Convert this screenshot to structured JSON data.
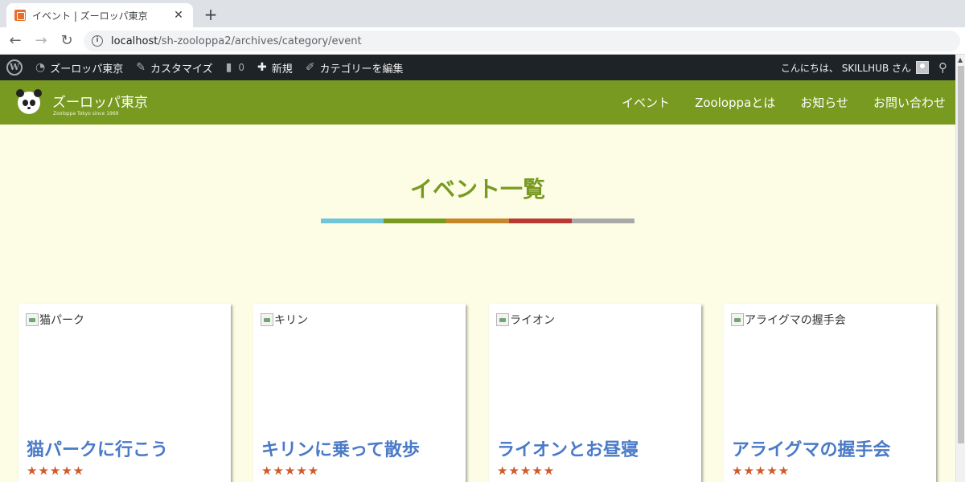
{
  "browser": {
    "tab_title": "イベント | ズーロッパ東京",
    "url_host": "localhost",
    "url_path": "/sh-zooloppa2/archives/category/event"
  },
  "adminbar": {
    "site_name": "ズーロッパ東京",
    "customize": "カスタマイズ",
    "comments_count": "0",
    "new_label": "新規",
    "edit_category": "カテゴリーを編集",
    "greeting": "こんにちは、 SKILLHUB さん"
  },
  "site": {
    "title": "ズーロッパ東京",
    "tagline": "Zooloppa Tokyo since 1969",
    "nav": [
      "イベント",
      "Zooloppaとは",
      "お知らせ",
      "お問い合わせ"
    ]
  },
  "page": {
    "heading": "イベント一覧",
    "accent_colors": [
      "#6ec6d8",
      "#789a20",
      "#c8862a",
      "#b83a32",
      "#a9a9a9"
    ]
  },
  "cards": [
    {
      "img_alt": "猫パーク",
      "title": "猫パークに行こう",
      "stars": "★★★★★"
    },
    {
      "img_alt": "キリン",
      "title": "キリンに乗って散歩",
      "stars": "★★★★★"
    },
    {
      "img_alt": "ライオン",
      "title": "ライオンとお昼寝",
      "stars": "★★★★★"
    },
    {
      "img_alt": "アライグマの握手会",
      "title": "アライグマの握手会",
      "stars": "★★★★★"
    }
  ],
  "colors": {
    "header_green": "#789a20",
    "page_bg": "#fdfde6",
    "title_blue": "#4a7ac8",
    "star_orange": "#d05a2a"
  },
  "icons": {
    "tab": [
      "favicon-icon",
      "close-icon",
      "plus-icon"
    ],
    "nav": [
      "back-arrow-icon",
      "forward-arrow-icon",
      "reload-icon",
      "info-icon"
    ],
    "adminbar": [
      "wordpress-icon",
      "dashboard-icon",
      "brush-icon",
      "comment-icon",
      "plus-icon",
      "pencil-icon",
      "avatar-icon",
      "search-icon"
    ]
  }
}
